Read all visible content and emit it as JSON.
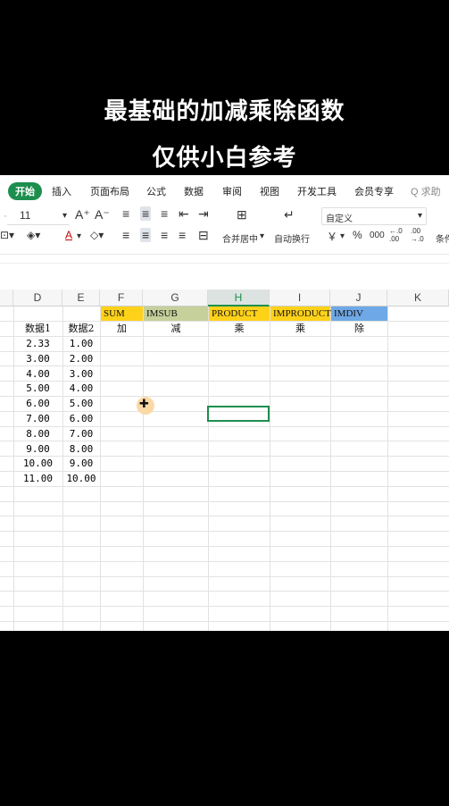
{
  "captions": {
    "line1": "最基础的加减乘除函数",
    "line2": "仅供小白参考"
  },
  "ribbon_tabs": [
    {
      "label": "开始",
      "active": true
    },
    {
      "label": "插入"
    },
    {
      "label": "页面布局"
    },
    {
      "label": "公式"
    },
    {
      "label": "数据"
    },
    {
      "label": "审阅"
    },
    {
      "label": "视图"
    },
    {
      "label": "开发工具"
    },
    {
      "label": "会员专享"
    }
  ],
  "search_label": "Q 求助",
  "toolbar": {
    "font_size": "11",
    "increase_font": "A⁺",
    "decrease_font": "A⁻",
    "merge_center": "合并居中",
    "wrap_text": "自动换行",
    "number_format": "自定义",
    "currency": "￥",
    "percent": "%",
    "thousands": "000",
    "inc_decimal": "←.0 .00",
    "dec_decimal": ".00 →.0",
    "conditional": "条件"
  },
  "columns": [
    "D",
    "E",
    "F",
    "G",
    "H",
    "I",
    "J",
    "K"
  ],
  "selected_column": "H",
  "function_headers": [
    {
      "col": "F",
      "label": "SUM",
      "color": "#ffd21a"
    },
    {
      "col": "G",
      "label": "IMSUB",
      "color": "#c5d09b"
    },
    {
      "col": "H",
      "label": "PRODUCT",
      "color": "#ffd21a"
    },
    {
      "col": "I",
      "label": "IMPRODUCT",
      "color": "#ffd21a"
    },
    {
      "col": "J",
      "label": "IMDIV",
      "color": "#6fa8e6"
    }
  ],
  "operation_labels": [
    "加",
    "减",
    "乘",
    "乘",
    "除"
  ],
  "data_headers": {
    "d": "数据1",
    "e": "数据2"
  },
  "data1": [
    "2.33",
    "3.00",
    "4.00",
    "5.00",
    "6.00",
    "7.00",
    "8.00",
    "9.00",
    "10.00",
    "11.00"
  ],
  "data2": [
    "1.00",
    "2.00",
    "3.00",
    "4.00",
    "5.00",
    "6.00",
    "7.00",
    "8.00",
    "9.00",
    "10.00"
  ]
}
